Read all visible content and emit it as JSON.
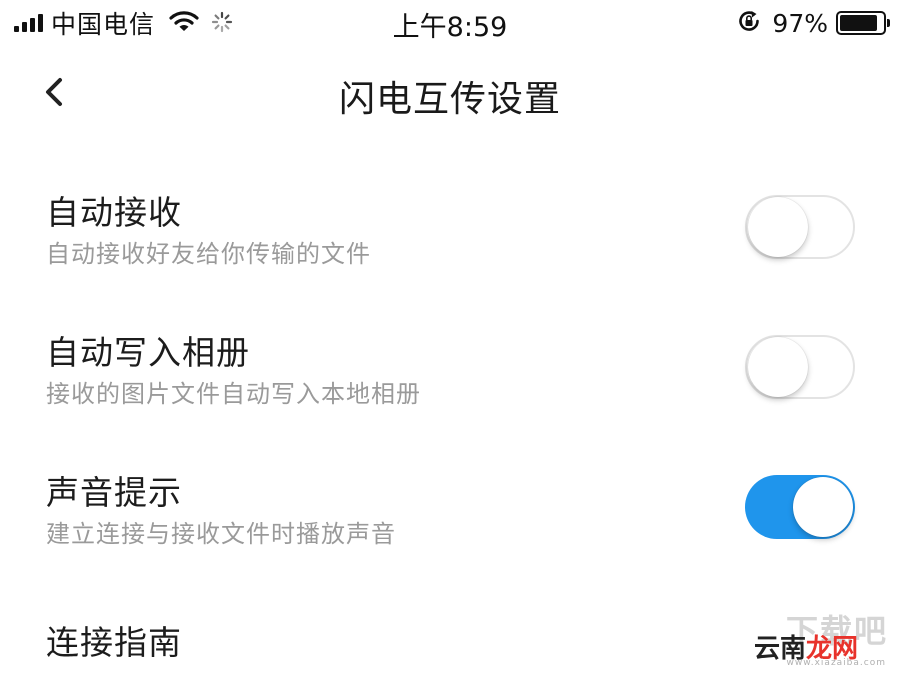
{
  "status_bar": {
    "carrier": "中国电信",
    "time": "上午8:59",
    "battery_percent": "97%",
    "battery_level": 0.97,
    "icons": [
      "signal-icon",
      "wifi-icon",
      "loading-icon",
      "rotation-lock-icon",
      "battery-icon"
    ]
  },
  "nav": {
    "title": "闪电互传设置",
    "back_icon": "chevron-left-icon"
  },
  "settings": [
    {
      "title": "自动接收",
      "subtitle": "自动接收好友给你传输的文件",
      "enabled": false
    },
    {
      "title": "自动写入相册",
      "subtitle": "接收的图片文件自动写入本地相册",
      "enabled": false
    },
    {
      "title": "声音提示",
      "subtitle": "建立连接与接收文件时播放声音",
      "enabled": true
    },
    {
      "title": "连接指南"
    }
  ],
  "colors": {
    "switch_on": "#1f95ec",
    "switch_off_border": "#e3e3e3",
    "subtitle": "#9a9a9a"
  },
  "watermark": {
    "top": "下载吧",
    "main_part1": "云南",
    "main_part2": "龙网",
    "url": "www.xiazaiba.com"
  }
}
